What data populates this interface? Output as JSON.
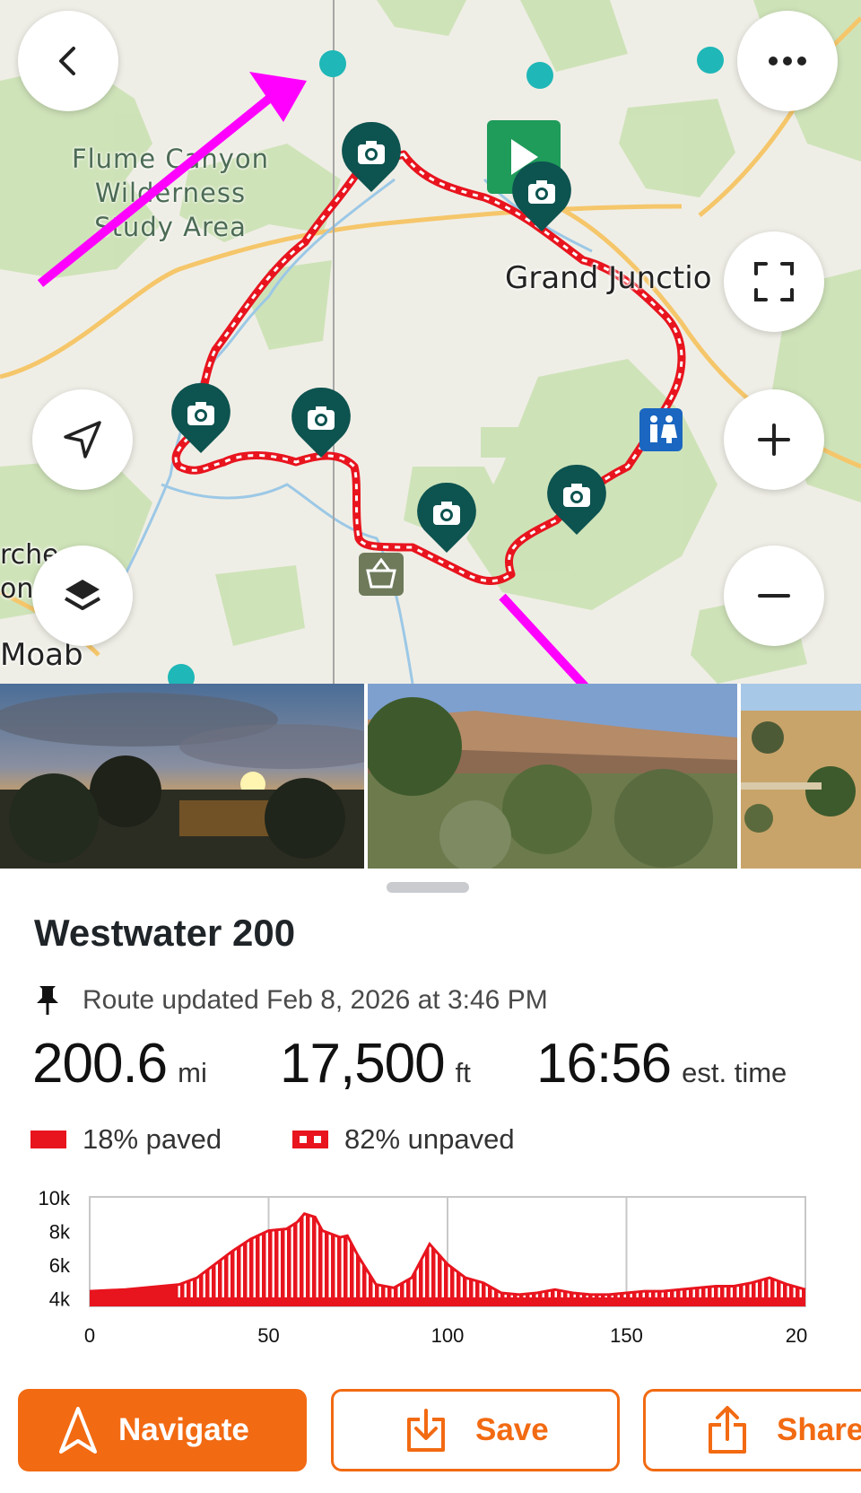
{
  "map": {
    "wilderness_label": "Flume Canyon Wilderness Study Area",
    "wilderness_lines": [
      "Flume Canyon",
      "Wilderness",
      "Study Area"
    ],
    "city_grand_junction": "Grand Junctio",
    "city_moab": "Moab",
    "arches_partial": [
      "rche",
      "on"
    ],
    "controls": {
      "back": "back-icon",
      "more": "more-icon",
      "fullscreen": "fullscreen-icon",
      "locate": "navigation-arrow-icon",
      "zoom_in": "plus-icon",
      "zoom_out": "minus-icon",
      "layers": "layers-icon"
    },
    "colors": {
      "route": "#e8141e",
      "poi_pin": "#0d5350",
      "annotation_arrow": "#f0f"
    }
  },
  "route": {
    "title": "Westwater 200",
    "updated": "Route updated Feb 8, 2026 at 3:46 PM",
    "stats": [
      {
        "value": "200.6",
        "unit": "mi"
      },
      {
        "value": "17,500",
        "unit": "ft"
      },
      {
        "value": "16:56",
        "unit": "est. time"
      }
    ],
    "surface": [
      {
        "label": "18% paved",
        "percent": 18
      },
      {
        "label": "82% unpaved",
        "percent": 82
      }
    ]
  },
  "chart_data": {
    "type": "area",
    "x": [
      0,
      10,
      20,
      25,
      30,
      35,
      40,
      45,
      50,
      55,
      58,
      60,
      63,
      65,
      70,
      72,
      75,
      80,
      85,
      90,
      95,
      100,
      105,
      110,
      115,
      120,
      125,
      130,
      135,
      140,
      145,
      150,
      155,
      160,
      165,
      170,
      175,
      180,
      185,
      190,
      195,
      200
    ],
    "y": [
      4400,
      4500,
      4700,
      4800,
      5200,
      6000,
      6800,
      7500,
      8000,
      8100,
      8500,
      9000,
      8800,
      8000,
      7600,
      7700,
      6500,
      4800,
      4600,
      5200,
      7200,
      6000,
      5200,
      4900,
      4300,
      4200,
      4300,
      4500,
      4300,
      4200,
      4200,
      4300,
      4400,
      4400,
      4500,
      4600,
      4700,
      4700,
      4900,
      5200,
      4800,
      4500
    ],
    "xlim": [
      0,
      200
    ],
    "ylim": [
      3500,
      10000
    ],
    "xticks": [
      "0",
      "50",
      "100",
      "150",
      "20"
    ],
    "yticks": [
      "10k",
      "8k",
      "6k",
      "4k"
    ],
    "grid": true
  },
  "actions": [
    {
      "label": "Navigate",
      "icon": "navigate-arrow-icon"
    },
    {
      "label": "Save",
      "icon": "download-icon"
    },
    {
      "label": "Share",
      "icon": "share-icon"
    }
  ]
}
